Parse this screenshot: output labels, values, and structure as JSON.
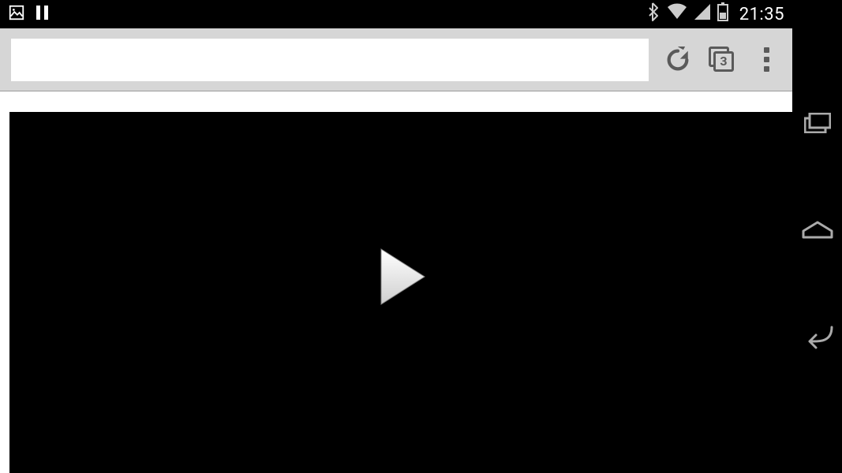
{
  "status": {
    "time": "21:35"
  },
  "browser": {
    "url_value": "",
    "url_placeholder": "",
    "tabs_count": "3"
  }
}
